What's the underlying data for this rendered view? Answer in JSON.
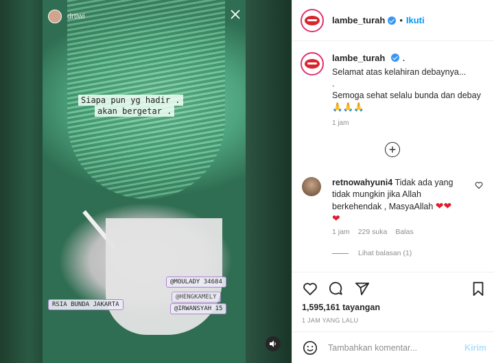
{
  "story": {
    "username": "drtiwi",
    "text_line1": "Siapa pun yg hadir .",
    "text_line2": "akan bergetar .",
    "location_tag": "RSIA BUNDA JAKARTA",
    "mention1": "@MOULADY 34684",
    "mention2": "@HENGKAMELY",
    "mention3": "@IRWANSYAH 15"
  },
  "header": {
    "username": "lambe_turah",
    "separator": "•",
    "follow_label": "Ikuti"
  },
  "caption": {
    "username": "lambe_turah",
    "trailing": ".",
    "line1": "Selamat atas kelahiran debaynya...",
    "line2": ".",
    "line3": "Semoga sehat selalu bunda dan debay",
    "emoji": "🙏🙏🙏",
    "time": "1 jam"
  },
  "comment": {
    "username": "retnowahyuni4",
    "text": "Tidak ada yang tidak mungkin jika Allah berkehendak , MasyaAllah",
    "hearts1": "❤❤",
    "hearts2": "❤",
    "time": "1 jam",
    "likes": "229 suka",
    "reply_label": "Balas",
    "view_replies": "Lihat balasan (1)"
  },
  "footer": {
    "views": "1,595,161 tayangan",
    "posted": "1 JAM YANG LALU",
    "comment_placeholder": "Tambahkan komentar...",
    "send_label": "Kirim"
  },
  "icons": {
    "like": "heart-icon",
    "comment": "comment-icon",
    "share": "share-icon",
    "save": "bookmark-icon",
    "emoji": "emoji-icon",
    "more": "plus-circle-icon",
    "close": "close-icon",
    "sound": "speaker-icon"
  },
  "colors": {
    "accent": "#0095f6",
    "verified": "#3897f0",
    "heart": "#e11d2d",
    "muted": "#8e8e8e"
  }
}
